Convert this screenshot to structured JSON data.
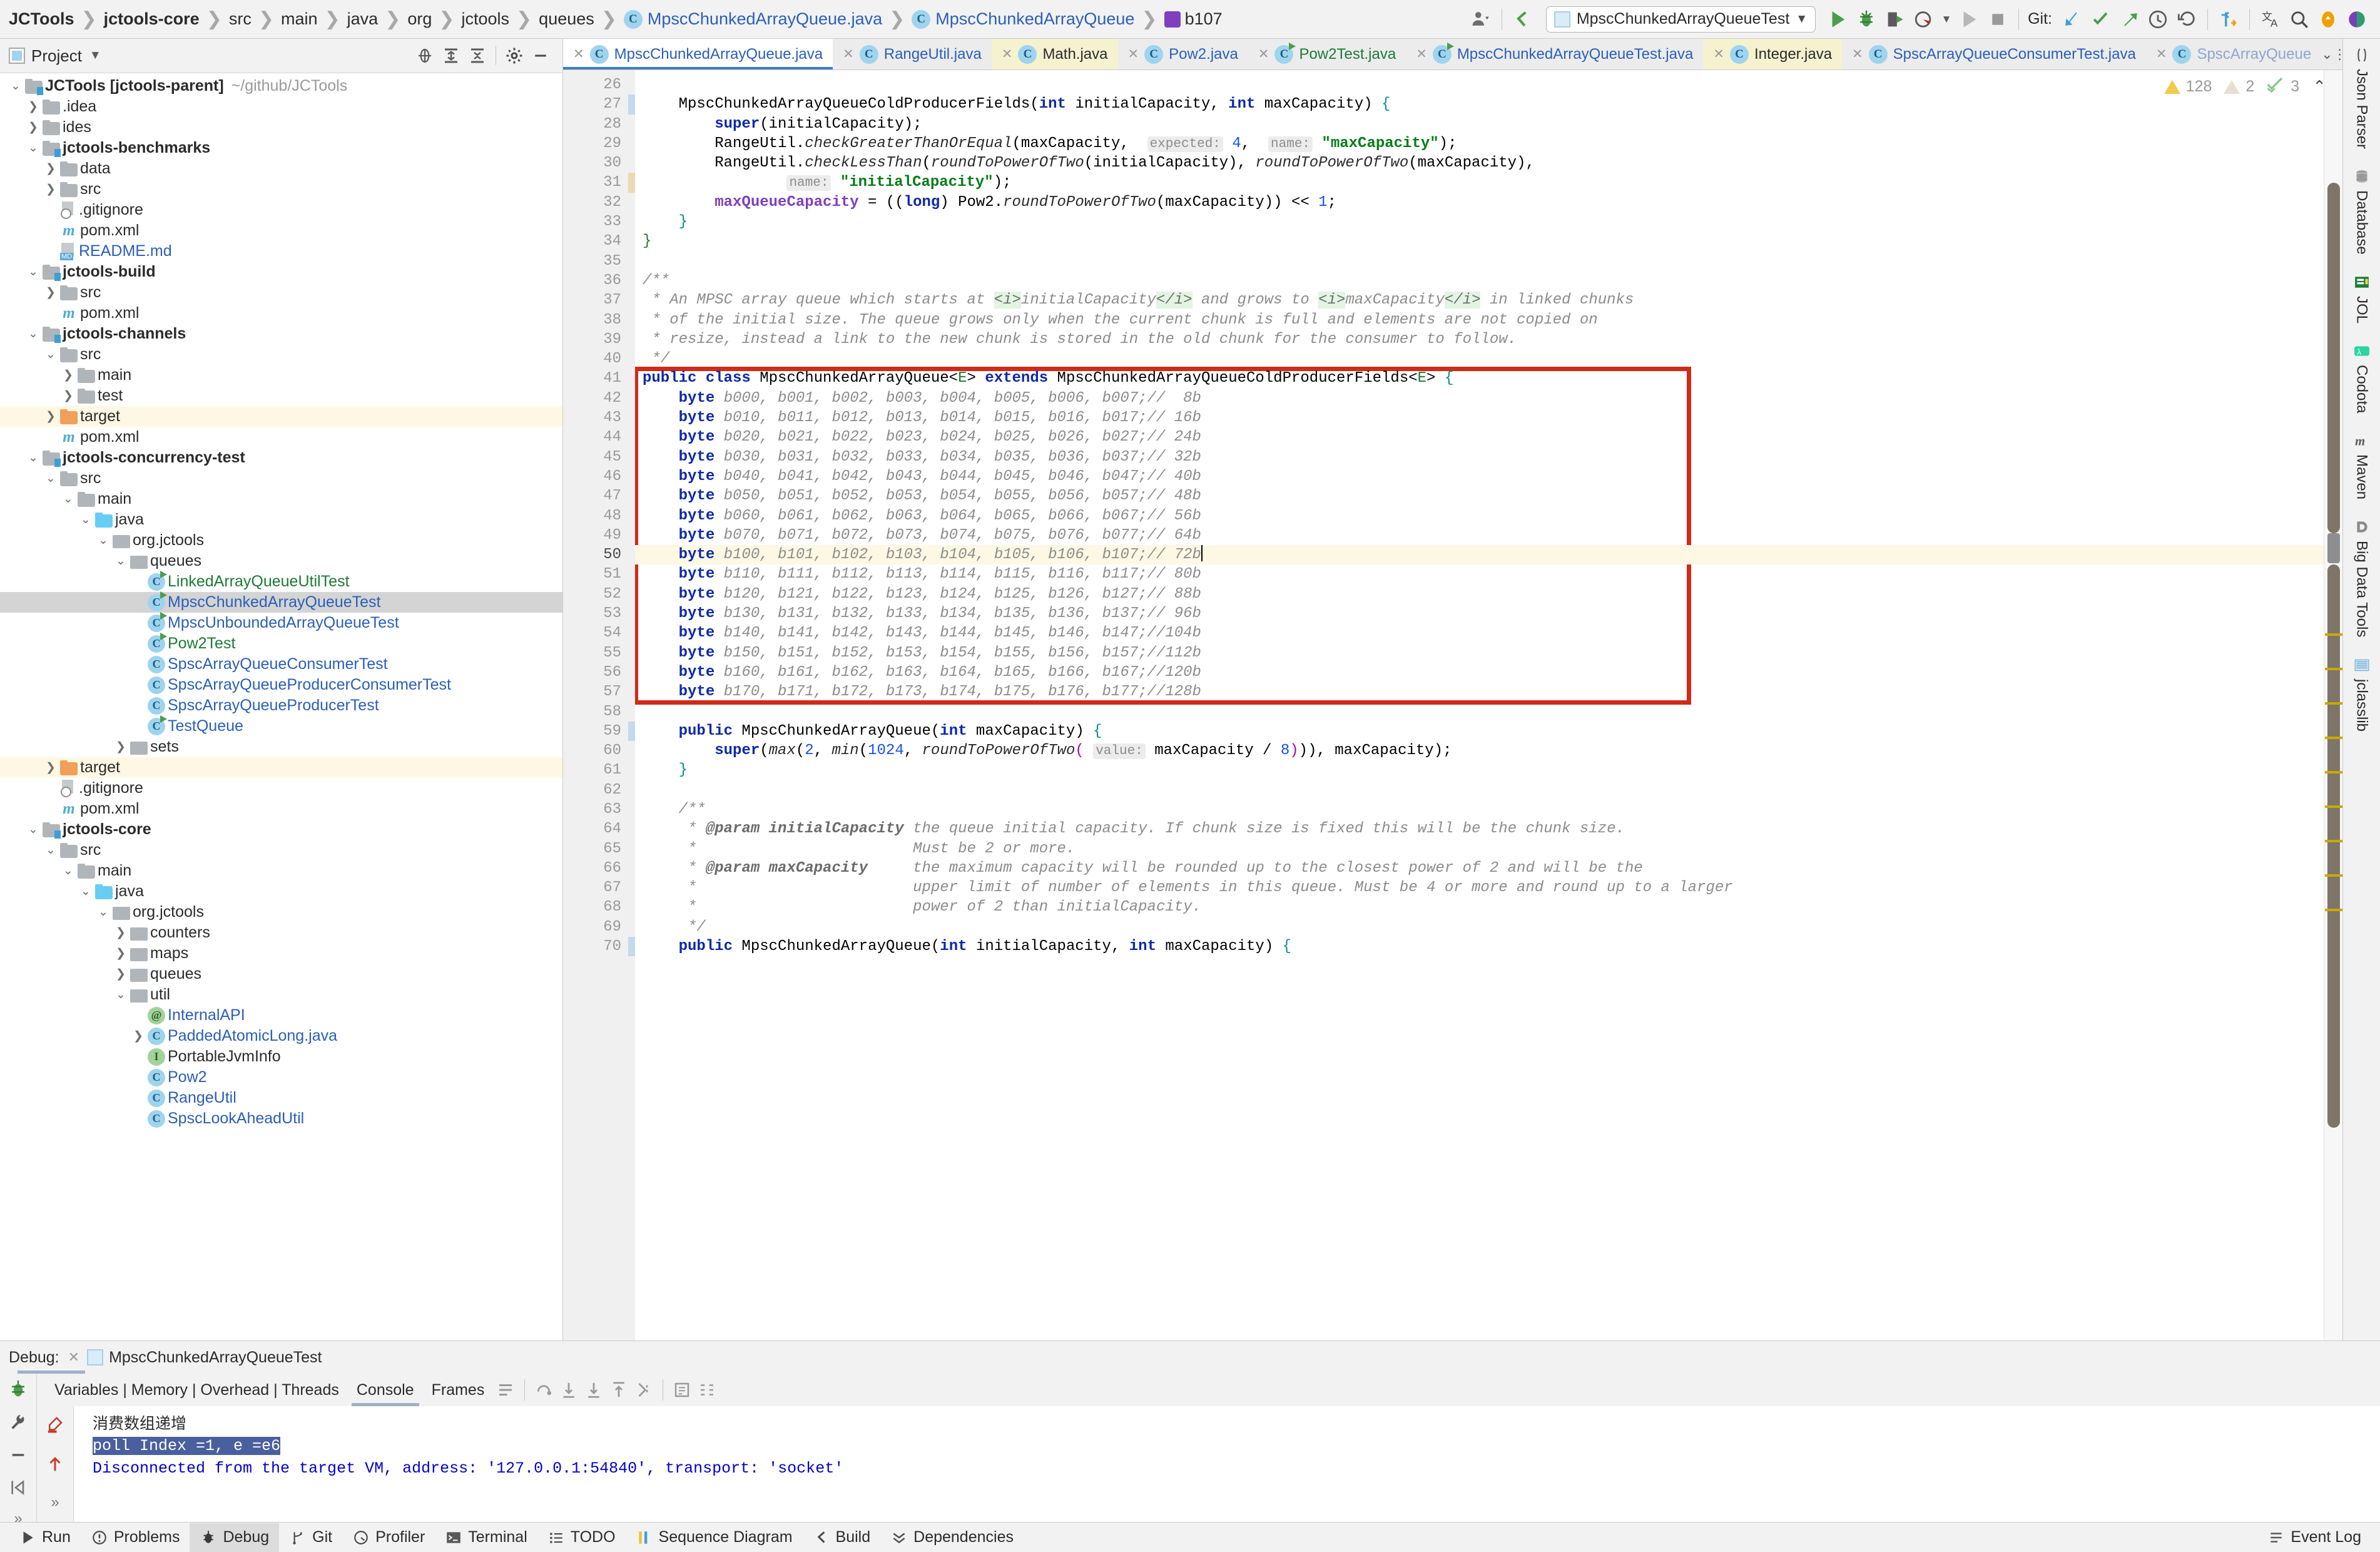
{
  "navbar": {
    "breadcrumb": [
      "JCTools",
      "jctools-core",
      "src",
      "main",
      "java",
      "org",
      "jctools",
      "queues"
    ],
    "class_crumb": "MpscChunkedArrayQueue.java",
    "class_crumb2": "MpscChunkedArrayQueue",
    "field_crumb": "b107",
    "run_config": "MpscChunkedArrayQueueTest",
    "git_label": "Git:",
    "icons": [
      "user-icon",
      "back-arrow-icon",
      "run-icon",
      "debug-icon",
      "run-with-coverage-icon",
      "profile-icon",
      "stop-icon",
      "update-project-icon",
      "commit-icon",
      "push-icon",
      "history-icon",
      "rollback-icon",
      "diff-icon",
      "translate-icon",
      "search-everywhere-icon",
      "notifications-icon",
      "ai-icon"
    ]
  },
  "project_panel": {
    "title": "Project",
    "header_icons": [
      "locate-icon",
      "expand-all-icon",
      "collapse-all-icon",
      "gear-icon",
      "minimize-icon"
    ],
    "tree": [
      {
        "depth": 0,
        "tw": "v",
        "icon": "module",
        "label": "JCTools [jctools-parent]",
        "bold": true,
        "path": "~/github/JCTools"
      },
      {
        "depth": 1,
        "tw": ">",
        "icon": "folder",
        "label": ".idea"
      },
      {
        "depth": 1,
        "tw": ">",
        "icon": "folder",
        "label": "ides"
      },
      {
        "depth": 1,
        "tw": "v",
        "icon": "module",
        "label": "jctools-benchmarks",
        "bold": true
      },
      {
        "depth": 2,
        "tw": ">",
        "icon": "folder",
        "label": "data"
      },
      {
        "depth": 2,
        "tw": ">",
        "icon": "folder",
        "label": "src"
      },
      {
        "depth": 2,
        "tw": "",
        "icon": "gitignore",
        "label": ".gitignore"
      },
      {
        "depth": 2,
        "tw": "",
        "icon": "maven",
        "label": "pom.xml"
      },
      {
        "depth": 2,
        "tw": "",
        "icon": "md",
        "label": "README.md",
        "blue": true
      },
      {
        "depth": 1,
        "tw": "v",
        "icon": "module",
        "label": "jctools-build",
        "bold": true
      },
      {
        "depth": 2,
        "tw": ">",
        "icon": "folder",
        "label": "src"
      },
      {
        "depth": 2,
        "tw": "",
        "icon": "maven",
        "label": "pom.xml"
      },
      {
        "depth": 1,
        "tw": "v",
        "icon": "module",
        "label": "jctools-channels",
        "bold": true
      },
      {
        "depth": 2,
        "tw": "v",
        "icon": "folder",
        "label": "src"
      },
      {
        "depth": 3,
        "tw": ">",
        "icon": "folder",
        "label": "main"
      },
      {
        "depth": 3,
        "tw": ">",
        "icon": "folder",
        "label": "test"
      },
      {
        "depth": 2,
        "tw": ">",
        "icon": "folder-orange",
        "label": "target",
        "hl": true
      },
      {
        "depth": 2,
        "tw": "",
        "icon": "maven",
        "label": "pom.xml"
      },
      {
        "depth": 1,
        "tw": "v",
        "icon": "module",
        "label": "jctools-concurrency-test",
        "bold": true
      },
      {
        "depth": 2,
        "tw": "v",
        "icon": "folder",
        "label": "src"
      },
      {
        "depth": 3,
        "tw": "v",
        "icon": "folder",
        "label": "main"
      },
      {
        "depth": 4,
        "tw": "v",
        "icon": "folder-src",
        "label": "java"
      },
      {
        "depth": 5,
        "tw": "v",
        "icon": "package",
        "label": "org.jctools"
      },
      {
        "depth": 6,
        "tw": "v",
        "icon": "package",
        "label": "queues"
      },
      {
        "depth": 7,
        "tw": "",
        "icon": "class-run",
        "label": "LinkedArrayQueueUtilTest",
        "green": true
      },
      {
        "depth": 7,
        "tw": "",
        "icon": "class-run",
        "label": "MpscChunkedArrayQueueTest",
        "blue": true,
        "sel": true
      },
      {
        "depth": 7,
        "tw": "",
        "icon": "class-run",
        "label": "MpscUnboundedArrayQueueTest",
        "blue": true
      },
      {
        "depth": 7,
        "tw": "",
        "icon": "class-run",
        "label": "Pow2Test",
        "green": true
      },
      {
        "depth": 7,
        "tw": "",
        "icon": "class",
        "label": "SpscArrayQueueConsumerTest",
        "blue": true
      },
      {
        "depth": 7,
        "tw": "",
        "icon": "class",
        "label": "SpscArrayQueueProducerConsumerTest",
        "blue": true
      },
      {
        "depth": 7,
        "tw": "",
        "icon": "class",
        "label": "SpscArrayQueueProducerTest",
        "blue": true
      },
      {
        "depth": 7,
        "tw": "",
        "icon": "class-run",
        "label": "TestQueue",
        "blue": true
      },
      {
        "depth": 6,
        "tw": ">",
        "icon": "package",
        "label": "sets"
      },
      {
        "depth": 2,
        "tw": ">",
        "icon": "folder-orange",
        "label": "target",
        "hl": true
      },
      {
        "depth": 2,
        "tw": "",
        "icon": "gitignore",
        "label": ".gitignore"
      },
      {
        "depth": 2,
        "tw": "",
        "icon": "maven",
        "label": "pom.xml"
      },
      {
        "depth": 1,
        "tw": "v",
        "icon": "module",
        "label": "jctools-core",
        "bold": true
      },
      {
        "depth": 2,
        "tw": "v",
        "icon": "folder",
        "label": "src"
      },
      {
        "depth": 3,
        "tw": "v",
        "icon": "folder",
        "label": "main"
      },
      {
        "depth": 4,
        "tw": "v",
        "icon": "folder-src",
        "label": "java"
      },
      {
        "depth": 5,
        "tw": "v",
        "icon": "package",
        "label": "org.jctools"
      },
      {
        "depth": 6,
        "tw": ">",
        "icon": "package",
        "label": "counters"
      },
      {
        "depth": 6,
        "tw": ">",
        "icon": "package",
        "label": "maps"
      },
      {
        "depth": 6,
        "tw": ">",
        "icon": "package",
        "label": "queues"
      },
      {
        "depth": 6,
        "tw": "v",
        "icon": "package",
        "label": "util"
      },
      {
        "depth": 7,
        "tw": "",
        "icon": "annotation",
        "label": "InternalAPI",
        "blue": true
      },
      {
        "depth": 7,
        "tw": ">",
        "icon": "class",
        "label": "PaddedAtomicLong.java",
        "blue": true
      },
      {
        "depth": 7,
        "tw": "",
        "icon": "interface",
        "label": "PortableJvmInfo"
      },
      {
        "depth": 7,
        "tw": "",
        "icon": "class",
        "label": "Pow2",
        "blue": true
      },
      {
        "depth": 7,
        "tw": "",
        "icon": "class",
        "label": "RangeUtil",
        "blue": true
      },
      {
        "depth": 7,
        "tw": "",
        "icon": "class",
        "label": "SpscLookAheadUtil",
        "blue": true
      }
    ]
  },
  "editor_tabs": [
    {
      "label": "MpscChunkedArrayQueue.java",
      "state": "active",
      "color": "blue",
      "icon": "class-icon"
    },
    {
      "label": "RangeUtil.java",
      "state": "normal",
      "color": "blue",
      "icon": "class-icon"
    },
    {
      "label": "Math.java",
      "state": "yellow",
      "color": "dark",
      "icon": "class-icon"
    },
    {
      "label": "Pow2.java",
      "state": "normal",
      "color": "blue",
      "icon": "class-icon"
    },
    {
      "label": "Pow2Test.java",
      "state": "normal",
      "color": "green",
      "icon": "class-run-icon"
    },
    {
      "label": "MpscChunkedArrayQueueTest.java",
      "state": "normal",
      "color": "blue",
      "icon": "class-run-icon"
    },
    {
      "label": "Integer.java",
      "state": "yellow",
      "color": "dark",
      "icon": "class-icon"
    },
    {
      "label": "SpscArrayQueueConsumerTest.java",
      "state": "normal",
      "color": "blue",
      "icon": "class-icon"
    },
    {
      "label": "SpscArrayQueue",
      "state": "normal",
      "color": "fade",
      "icon": "class-icon"
    }
  ],
  "inspections": {
    "warnings": "128",
    "weak_warnings": "2",
    "passed": "3"
  },
  "code": {
    "first_line": 26,
    "cursor_line": 50,
    "lines": [
      {
        "n": 26,
        "html": ""
      },
      {
        "n": 27,
        "marker": "blue",
        "fold": "-",
        "html": "    MpscChunkedArrayQueueColdProducerFields(<span class=\"kw\">int</span> initialCapacity, <span class=\"kw\">int</span> maxCapacity) <span class=\"pl1\">{</span>"
      },
      {
        "n": 28,
        "html": "        <span class=\"kw\">super</span>(initialCapacity);"
      },
      {
        "n": 29,
        "html": "        RangeUtil.<span class=\"mth\">checkGreaterThanOrEqual</span>(maxCapacity,  <span class=\"hint\">expected:</span> <span class=\"num\">4</span>,  <span class=\"hint\">name:</span> <span class=\"str\">\"maxCapacity\"</span>);"
      },
      {
        "n": 30,
        "html": "        RangeUtil.<span class=\"mth\">checkLessThan</span>(<span class=\"mth\">roundToPowerOfTwo</span>(initialCapacity), <span class=\"mth\">roundToPowerOfTwo</span>(maxCapacity),"
      },
      {
        "n": 31,
        "marker": "tan",
        "html": "                <span class=\"hint\">name:</span> <span class=\"str\">\"initialCapacity\"</span>);"
      },
      {
        "n": 32,
        "html": "        <span class=\"fld\">maxQueueCapacity</span> = ((<span class=\"kw\">long</span>) Pow2.<span class=\"mth\">roundToPowerOfTwo</span>(maxCapacity)) &lt;&lt; <span class=\"num\">1</span>;"
      },
      {
        "n": 33,
        "fold": "-",
        "html": "    <span class=\"pl1\">}</span>"
      },
      {
        "n": 34,
        "fold": "-",
        "html": "<span class=\"gen\">}</span>"
      },
      {
        "n": 35,
        "html": ""
      },
      {
        "n": 36,
        "fold": "-",
        "html": "<span class=\"doc\">/**</span>"
      },
      {
        "n": 37,
        "html": "<span class=\"doc\"> * An MPSC array queue which starts at </span><span class=\"htag\">&lt;i&gt;</span><span class=\"doc\">initialCapacity</span><span class=\"htag\">&lt;/i&gt;</span><span class=\"doc\"> and grows to </span><span class=\"htag\">&lt;i&gt;</span><span class=\"doc\">maxCapacity</span><span class=\"htag\">&lt;/i&gt;</span><span class=\"doc\"> in linked chunks</span>"
      },
      {
        "n": 38,
        "html": "<span class=\"doc\"> * of the initial size. The queue grows only when the current chunk is full and elements are not copied on</span>"
      },
      {
        "n": 39,
        "html": "<span class=\"doc\"> * resize, instead a link to the new chunk is stored in the old chunk for the consumer to follow.</span>"
      },
      {
        "n": 40,
        "fold": "-",
        "html": "<span class=\"doc\"> */</span>"
      },
      {
        "n": 41,
        "bp": true,
        "fold": "-",
        "html": "<span class=\"kw\">public class</span> MpscChunkedArrayQueue&lt;<span class=\"gen\">E</span>&gt; <span class=\"kw\">extends</span> MpscChunkedArrayQueueColdProducerFields&lt;<span class=\"gen\">E</span>&gt; <span class=\"pl1\">{</span>"
      },
      {
        "n": 42,
        "html": "    <span class=\"kw\">byte</span> <span class=\"cm\">b000, b001, b002, b003, b004, b005, b006, b007;</span><span class=\"cm\">//  8b</span>"
      },
      {
        "n": 43,
        "html": "    <span class=\"kw\">byte</span> <span class=\"cm\">b010, b011, b012, b013, b014, b015, b016, b017;</span><span class=\"cm\">// 16b</span>"
      },
      {
        "n": 44,
        "html": "    <span class=\"kw\">byte</span> <span class=\"cm\">b020, b021, b022, b023, b024, b025, b026, b027;</span><span class=\"cm\">// 24b</span>"
      },
      {
        "n": 45,
        "html": "    <span class=\"kw\">byte</span> <span class=\"cm\">b030, b031, b032, b033, b034, b035, b036, b037;</span><span class=\"cm\">// 32b</span>"
      },
      {
        "n": 46,
        "html": "    <span class=\"kw\">byte</span> <span class=\"cm\">b040, b041, b042, b043, b044, b045, b046, b047;</span><span class=\"cm\">// 40b</span>"
      },
      {
        "n": 47,
        "html": "    <span class=\"kw\">byte</span> <span class=\"cm\">b050, b051, b052, b053, b054, b055, b056, b057;</span><span class=\"cm\">// 48b</span>"
      },
      {
        "n": 48,
        "html": "    <span class=\"kw\">byte</span> <span class=\"cm\">b060, b061, b062, b063, b064, b065, b066, b067;</span><span class=\"cm\">// 56b</span>"
      },
      {
        "n": 49,
        "html": "    <span class=\"kw\">byte</span> <span class=\"cm\">b070, b071, b072, b073, b074, b075, b076, b077;</span><span class=\"cm\">// 64b</span>"
      },
      {
        "n": 50,
        "cur": true,
        "html": "    <span class=\"kw\">byte</span> <span class=\"cm\">b100, b101, b102, b103, b104, b105, b106, b107;</span><span class=\"cm\">// 72b</span><span class=\"caret-blink\"></span>"
      },
      {
        "n": 51,
        "html": "    <span class=\"kw\">byte</span> <span class=\"cm\">b110, b111, b112, b113, b114, b115, b116, b117;</span><span class=\"cm\">// 80b</span>"
      },
      {
        "n": 52,
        "html": "    <span class=\"kw\">byte</span> <span class=\"cm\">b120, b121, b122, b123, b124, b125, b126, b127;</span><span class=\"cm\">// 88b</span>"
      },
      {
        "n": 53,
        "html": "    <span class=\"kw\">byte</span> <span class=\"cm\">b130, b131, b132, b133, b134, b135, b136, b137;</span><span class=\"cm\">// 96b</span>"
      },
      {
        "n": 54,
        "html": "    <span class=\"kw\">byte</span> <span class=\"cm\">b140, b141, b142, b143, b144, b145, b146, b147;</span><span class=\"cm\">//104b</span>"
      },
      {
        "n": 55,
        "html": "    <span class=\"kw\">byte</span> <span class=\"cm\">b150, b151, b152, b153, b154, b155, b156, b157;</span><span class=\"cm\">//112b</span>"
      },
      {
        "n": 56,
        "html": "    <span class=\"kw\">byte</span> <span class=\"cm\">b160, b161, b162, b163, b164, b165, b166, b167;</span><span class=\"cm\">//120b</span>"
      },
      {
        "n": 57,
        "html": "    <span class=\"kw\">byte</span> <span class=\"cm\">b170, b171, b172, b173, b174, b175, b176, b177;</span><span class=\"cm\">//128b</span>"
      },
      {
        "n": 58,
        "html": ""
      },
      {
        "n": 59,
        "marker": "blue",
        "fold": "-",
        "html": "    <span class=\"kw\">public</span> MpscChunkedArrayQueue(<span class=\"kw\">int</span> maxCapacity) <span class=\"pl1\">{</span>"
      },
      {
        "n": 60,
        "html": "        <span class=\"kw\">super</span>(<span class=\"mth\">max</span>(<span class=\"num\">2</span>, <span class=\"mth\">min</span>(<span class=\"num\">1024</span>, <span class=\"mth\">roundToPowerOfTwo</span><span class=\"pl3\">(</span> <span class=\"hint\">value:</span> maxCapacity / <span class=\"num\">8</span><span class=\"pl3\">)</span>)), maxCapacity);"
      },
      {
        "n": 61,
        "fold": "-",
        "html": "    <span class=\"pl1\">}</span>"
      },
      {
        "n": 62,
        "html": ""
      },
      {
        "n": 63,
        "fold": "-",
        "html": "    <span class=\"doc\">/**</span>"
      },
      {
        "n": 64,
        "html": "     <span class=\"doc\">* </span><span class=\"doct\">@param initialCapacity</span><span class=\"doc\"> the queue initial capacity. If chunk size is fixed this will be the chunk size.</span>"
      },
      {
        "n": 65,
        "html": "     <span class=\"doc\">*                        Must be 2 or more.</span>"
      },
      {
        "n": 66,
        "html": "     <span class=\"doc\">* </span><span class=\"doct\">@param maxCapacity</span><span class=\"doc\">     the maximum capacity will be rounded up to the closest power of 2 and will be the</span>"
      },
      {
        "n": 67,
        "html": "     <span class=\"doc\">*                        upper limit of number of elements in this queue. Must be 4 or more and round up to a larger</span>"
      },
      {
        "n": 68,
        "html": "     <span class=\"doc\">*                        power of 2 than initialCapacity.</span>"
      },
      {
        "n": 69,
        "fold": "-",
        "html": "     <span class=\"doc\">*/</span>"
      },
      {
        "n": 70,
        "marker": "blue",
        "fold": "-",
        "html": "    <span class=\"kw\">public</span> MpscChunkedArrayQueue(<span class=\"kw\">int</span> initialCapacity, <span class=\"kw\">int</span> maxCapacity) <span class=\"pl1\">{</span>"
      }
    ]
  },
  "right_tools": [
    {
      "label": "Json Parser",
      "icon": "json-icon"
    },
    {
      "label": "Database",
      "icon": "database-icon"
    },
    {
      "label": "JOL",
      "icon": "jol-icon"
    },
    {
      "label": "Codota",
      "icon": "codota-icon"
    },
    {
      "label": "Maven",
      "icon": "maven-icon"
    },
    {
      "label": "Big Data Tools",
      "icon": "bigdata-icon"
    },
    {
      "label": "jclasslib",
      "icon": "jclasslib-icon"
    }
  ],
  "debug": {
    "label": "Debug:",
    "session": "MpscChunkedArrayQueueTest",
    "tabs": [
      "Variables | Memory | Overhead | Threads",
      "Console",
      "Frames"
    ],
    "active_tab": "Console",
    "toolbar_icons": [
      "soft-wrap-icon",
      "step-over-icon",
      "step-into-icon",
      "force-step-into-icon",
      "step-out-icon",
      "run-to-cursor-icon",
      "evaluate-icon",
      "settings-icon"
    ],
    "left_icons": [
      "debug-bug-icon",
      "wrench-icon",
      "mute-icon",
      "resume-icon",
      "more-icon"
    ],
    "console_gutter_icons": [
      "clear-icon",
      "scroll-up-icon",
      "scroll-end-icon"
    ],
    "console_lines": [
      {
        "text": "消费数组递增",
        "style": "cjk"
      },
      {
        "text": "poll Index =1, e =e6",
        "style": "selected"
      },
      {
        "text": "Disconnected from the target VM, address: '127.0.0.1:54840', transport: 'socket'",
        "style": "blue"
      }
    ]
  },
  "statusbar": {
    "items": [
      {
        "label": "Run",
        "icon": "run-icon"
      },
      {
        "label": "Problems",
        "icon": "problems-icon"
      },
      {
        "label": "Debug",
        "icon": "debug-icon",
        "active": true
      },
      {
        "label": "Git",
        "icon": "git-icon"
      },
      {
        "label": "Profiler",
        "icon": "profiler-icon"
      },
      {
        "label": "Terminal",
        "icon": "terminal-icon"
      },
      {
        "label": "TODO",
        "icon": "todo-icon"
      },
      {
        "label": "Sequence Diagram",
        "icon": "sequence-diagram-icon"
      },
      {
        "label": "Build",
        "icon": "build-icon"
      },
      {
        "label": "Dependencies",
        "icon": "dependencies-icon"
      }
    ],
    "right_label": "Event Log",
    "right_icon": "event-log-icon"
  },
  "colors": {
    "accent_blue": "#3f7cc9",
    "keyword": "#0c29a8",
    "string": "#067d17",
    "comment": "#8c8c8c",
    "field": "#7f3fbf",
    "highlight_box": "#cf2b19",
    "selection": "#d4d4d4",
    "current_line": "#fdf8e3"
  }
}
